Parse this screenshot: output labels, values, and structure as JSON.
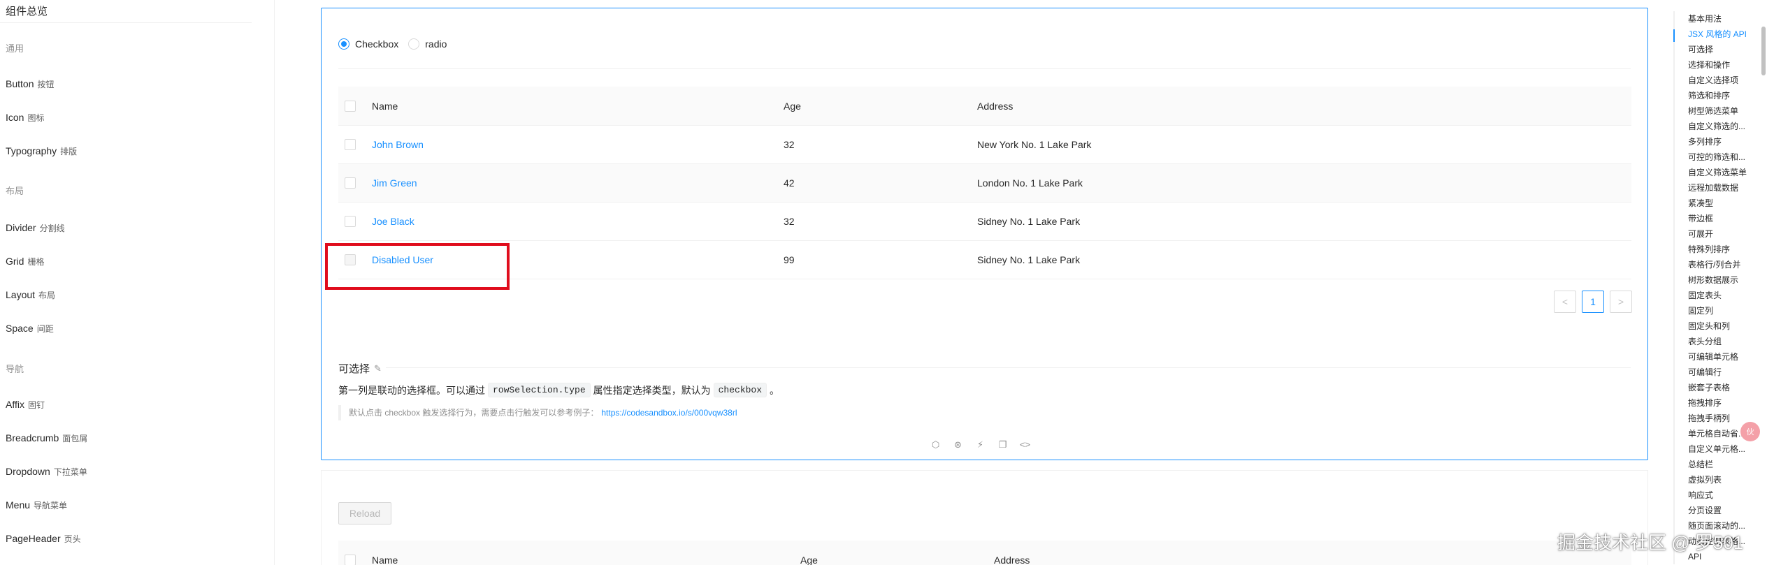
{
  "sidebar": {
    "top_title": "组件总览",
    "groups": [
      {
        "label": "通用"
      },
      {
        "label": "布局"
      },
      {
        "label": "导航"
      }
    ],
    "items": [
      {
        "en": "Button",
        "cn": "按钮"
      },
      {
        "en": "Icon",
        "cn": "图标"
      },
      {
        "en": "Typography",
        "cn": "排版"
      },
      {
        "en": "Divider",
        "cn": "分割线"
      },
      {
        "en": "Grid",
        "cn": "栅格"
      },
      {
        "en": "Layout",
        "cn": "布局"
      },
      {
        "en": "Space",
        "cn": "间距"
      },
      {
        "en": "Affix",
        "cn": "固钉"
      },
      {
        "en": "Breadcrumb",
        "cn": "面包屑"
      },
      {
        "en": "Dropdown",
        "cn": "下拉菜单"
      },
      {
        "en": "Menu",
        "cn": "导航菜单"
      },
      {
        "en": "PageHeader",
        "cn": "页头"
      }
    ]
  },
  "demo": {
    "radio_options": [
      "Checkbox",
      "radio"
    ],
    "selected_radio": "Checkbox",
    "columns": [
      "Name",
      "Age",
      "Address"
    ],
    "rows": [
      {
        "name": "John Brown",
        "age": "32",
        "address": "New York No. 1 Lake Park"
      },
      {
        "name": "Jim Green",
        "age": "42",
        "address": "London No. 1 Lake Park"
      },
      {
        "name": "Joe Black",
        "age": "32",
        "address": "Sidney No. 1 Lake Park"
      },
      {
        "name": "Disabled User",
        "age": "99",
        "address": "Sidney No. 1 Lake Park"
      }
    ],
    "pagination": {
      "prev": "<",
      "current": "1",
      "next": ">"
    },
    "meta": {
      "title": "可选择",
      "edit_icon": "✎",
      "desc_before": "第一列是联动的选择框。可以通过",
      "code1": "rowSelection.type",
      "desc_mid": "属性指定选择类型，默认为",
      "code2": "checkbox",
      "desc_after": "。",
      "quote_text": "默认点击 checkbox 触发选择行为，需要点击行触发可以参考例子：",
      "quote_link": "https://codesandbox.io/s/000vqw38rl"
    },
    "actions": [
      "⬡",
      "⊛",
      "⚡",
      "❐",
      "<>"
    ]
  },
  "demo2": {
    "reload_label": "Reload",
    "columns": [
      "Name",
      "Age",
      "Address"
    ]
  },
  "anchor": {
    "items": [
      "基本用法",
      "JSX 风格的 API",
      "可选择",
      "选择和操作",
      "自定义选择项",
      "筛选和排序",
      "树型筛选菜单",
      "自定义筛选的...",
      "多列排序",
      "可控的筛选和...",
      "自定义筛选菜单",
      "远程加载数据",
      "紧凑型",
      "带边框",
      "可展开",
      "特殊列排序",
      "表格行/列合并",
      "树形数据展示",
      "固定表头",
      "固定列",
      "固定头和列",
      "表头分组",
      "可编辑单元格",
      "可编辑行",
      "嵌套子表格",
      "拖拽排序",
      "拖拽手柄列",
      "单元格自动省...",
      "自定义单元格...",
      "总结栏",
      "虚拟列表",
      "响应式",
      "分页设置",
      "随页面滚动的...",
      "动态控制表格...",
      "API"
    ],
    "active_index": 1
  },
  "bubble_text": "伙",
  "watermark": "掘金技术社区 @ 罗501"
}
